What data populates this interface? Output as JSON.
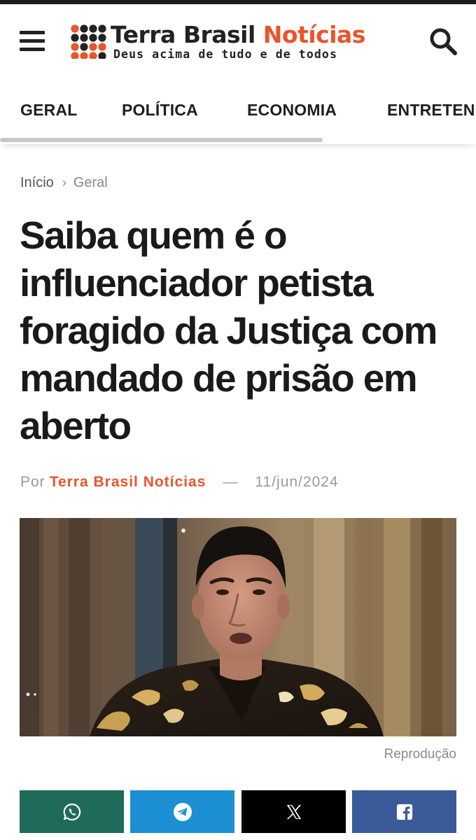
{
  "site": {
    "name_main": "Terra Brasil",
    "name_accent": "Notícias",
    "tagline": "Deus acima de tudo e de todos",
    "accent_color": "#e8552b"
  },
  "icons": {
    "menu": "hamburger-menu-icon",
    "search": "search-icon",
    "breadcrumb_separator": "chevron-right-icon"
  },
  "nav": {
    "items": [
      "GERAL",
      "POLÍTICA",
      "ECONOMIA",
      "ENTRETENIMENTO"
    ]
  },
  "breadcrumb": {
    "home": "Início",
    "current": "Geral"
  },
  "article": {
    "title": "Saiba quem é o influenciador petista foragido da Justiça com mandado de prisão em aberto",
    "by_label": "Por",
    "author": "Terra Brasil Notícias",
    "dash": "—",
    "date": "11/jun/2024",
    "image_caption": "Reprodução"
  },
  "share": {
    "buttons": [
      {
        "network": "whatsapp",
        "icon": "whatsapp-icon",
        "color": "#1e6b5a"
      },
      {
        "network": "telegram",
        "icon": "telegram-icon",
        "color": "#1d8fd4"
      },
      {
        "network": "x",
        "icon": "x-icon",
        "color": "#000000"
      },
      {
        "network": "facebook",
        "icon": "facebook-icon",
        "color": "#3b5a99"
      }
    ]
  }
}
